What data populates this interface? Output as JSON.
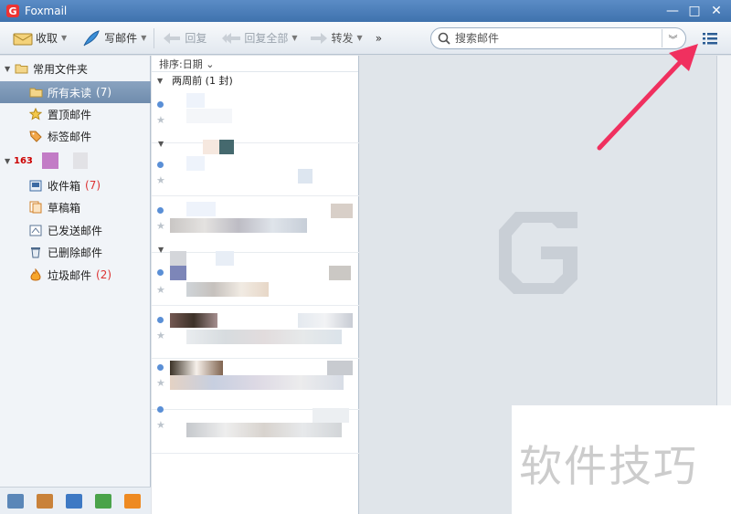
{
  "window": {
    "title": "Foxmail",
    "logo_text": "G",
    "minimize": "—",
    "maximize": "□",
    "close": "✕"
  },
  "toolbar": {
    "receive_label": "收取",
    "compose_label": "写邮件",
    "reply_label": "回复",
    "reply_all_label": "回复全部",
    "forward_label": "转发",
    "more_label": "»",
    "search_placeholder": "搜索邮件",
    "search_options": "»"
  },
  "sidebar": {
    "favorites_title": "常用文件夹",
    "favorites": [
      {
        "label": "所有未读",
        "count": "(7)",
        "icon": "folder-icon"
      },
      {
        "label": "置顶邮件",
        "count": "",
        "icon": "star-icon"
      },
      {
        "label": "标签邮件",
        "count": "",
        "icon": "tag-icon"
      }
    ],
    "account_badge": "163",
    "account_folders": [
      {
        "label": "收件箱",
        "count": "(7)",
        "icon": "inbox-icon"
      },
      {
        "label": "草稿箱",
        "count": "",
        "icon": "drafts-icon"
      },
      {
        "label": "已发送邮件",
        "count": "",
        "icon": "sent-icon"
      },
      {
        "label": "已删除邮件",
        "count": "",
        "icon": "trash-icon"
      },
      {
        "label": "垃圾邮件",
        "count": "(2)",
        "icon": "junk-icon"
      }
    ],
    "bottom_icons": [
      "mail-icon",
      "contacts-icon",
      "calendar-icon",
      "notes-icon",
      "rss-icon"
    ]
  },
  "list": {
    "sort_label": "排序:日期 ⌄",
    "group_label": "两周前 (1 封)"
  },
  "reading_pane": {
    "watermark": "foxmail-logo-icon"
  },
  "overlay": {
    "text": "软件技巧"
  },
  "colors": {
    "accent": "#4a7db8",
    "unread_dot": "#5a8fd6",
    "count_red": "#d33",
    "arrow": "#f0305f"
  }
}
